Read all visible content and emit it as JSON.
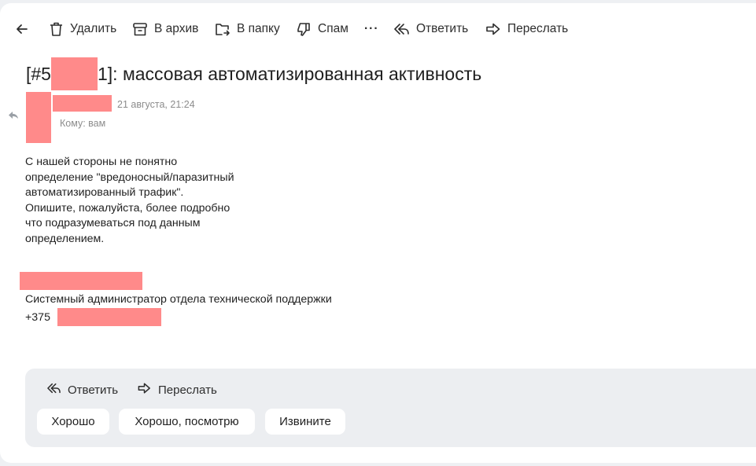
{
  "toolbar": {
    "delete_label": "Удалить",
    "archive_label": "В архив",
    "folder_label": "В папку",
    "spam_label": "Спам",
    "more_label": "···",
    "reply_label": "Ответить",
    "forward_label": "Переслать"
  },
  "message": {
    "subject_prefix": "[#5",
    "subject_suffix": "1]: массовая автоматизированная активность",
    "date": "21 августа, 21:24",
    "to": "Кому: вам",
    "body_lines": [
      "С нашей стороны не понятно",
      "определение \"вредоносный/паразитный",
      "автоматизированный трафик\".",
      "Опишите, пожалуйста, более подробно",
      "что подразумеваться под данным",
      "определением."
    ],
    "signature_title": "Системный администратор отдела технической поддержки",
    "signature_phone_prefix": "+375"
  },
  "reply_panel": {
    "reply_label": "Ответить",
    "forward_label": "Переслать",
    "quick_replies": [
      "Хорошо",
      "Хорошо, посмотрю",
      "Извините"
    ]
  },
  "colors": {
    "redaction": "#ff8a8a",
    "panel_bg": "#eceef1",
    "muted_text": "#8c8c8c"
  }
}
